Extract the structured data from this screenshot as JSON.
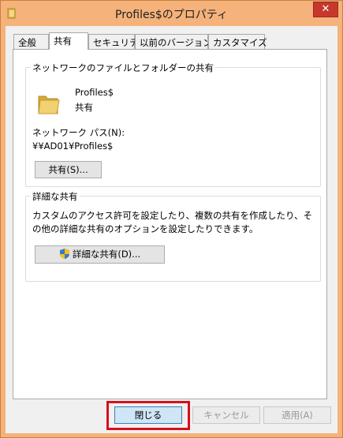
{
  "window": {
    "title": "Profiles$のプロパティ",
    "close_glyph": "✕"
  },
  "tabs": [
    {
      "label": "全般",
      "active": false
    },
    {
      "label": "共有",
      "active": true
    },
    {
      "label": "セキュリティ",
      "active": false
    },
    {
      "label": "以前のバージョン",
      "active": false
    },
    {
      "label": "カスタマイズ",
      "active": false
    }
  ],
  "network_share": {
    "group_title": "ネットワークのファイルとフォルダーの共有",
    "folder_name": "Profiles$",
    "share_status": "共有",
    "path_label": "ネットワーク パス(N):",
    "path_value": "¥¥AD01¥Profiles$",
    "share_button": "共有(S)..."
  },
  "advanced_share": {
    "group_title": "詳細な共有",
    "description": "カスタムのアクセス許可を設定したり、複数の共有を作成したり、その他の詳細な共有のオプションを設定したりできます。",
    "button": "詳細な共有(D)..."
  },
  "footer": {
    "close": "閉じる",
    "cancel": "キャンセル",
    "apply": "適用(A)"
  },
  "colors": {
    "titlebar": "#f5b27b",
    "close": "#c7382c",
    "highlight": "#d6101c",
    "folder": "#e8c25a"
  }
}
